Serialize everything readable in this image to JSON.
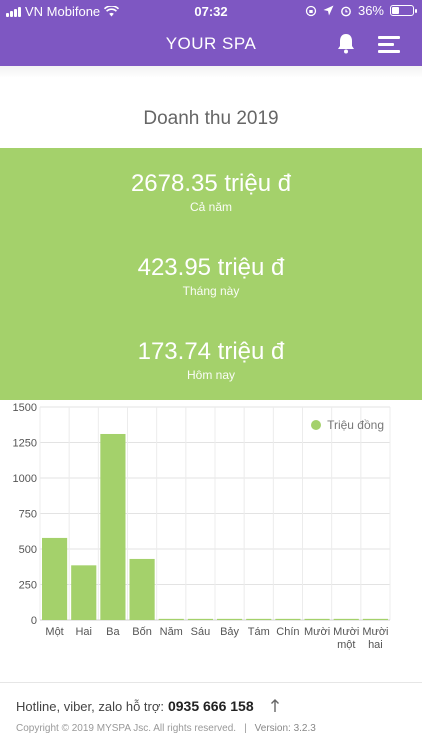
{
  "status_bar": {
    "carrier": "VN Mobifone",
    "time": "07:32",
    "battery": "36%",
    "battery_level": 0.36
  },
  "header": {
    "title": "YOUR SPA",
    "icons": [
      "bell-icon",
      "hamburger-menu-icon"
    ]
  },
  "page": {
    "title": "Doanh thu 2019"
  },
  "stats": [
    {
      "value": "2678.35 triệu đ",
      "label": "Cả năm"
    },
    {
      "value": "423.95 triệu đ",
      "label": "Tháng này"
    },
    {
      "value": "173.74 triệu đ",
      "label": "Hôm nay"
    }
  ],
  "colors": {
    "header": "#7e57c2",
    "accent": "#a4d16b"
  },
  "chart_data": {
    "type": "bar",
    "categories": [
      "Một",
      "Hai",
      "Ba",
      "Bốn",
      "Năm",
      "Sáu",
      "Bảy",
      "Tám",
      "Chín",
      "Mười",
      "Mười một",
      "Mười hai"
    ],
    "series": [
      {
        "name": "Triệu đồng",
        "values": [
          578,
          385,
          1310,
          430,
          8,
          8,
          8,
          8,
          8,
          8,
          8,
          8
        ]
      }
    ],
    "yticks": [
      "0",
      "250",
      "500",
      "750",
      "1000",
      "1250",
      "1500"
    ],
    "ylim": [
      0,
      1500
    ],
    "grid": true,
    "legend": "top-right"
  },
  "footer": {
    "hotline_label": "Hotline, viber, zalo hỗ trợ:",
    "hotline_number": "0935 666 158",
    "copyright": "Copyright © 2019 MYSPA Jsc. All rights reserved.",
    "separator": "|",
    "version": "Version: 3.2.3"
  }
}
